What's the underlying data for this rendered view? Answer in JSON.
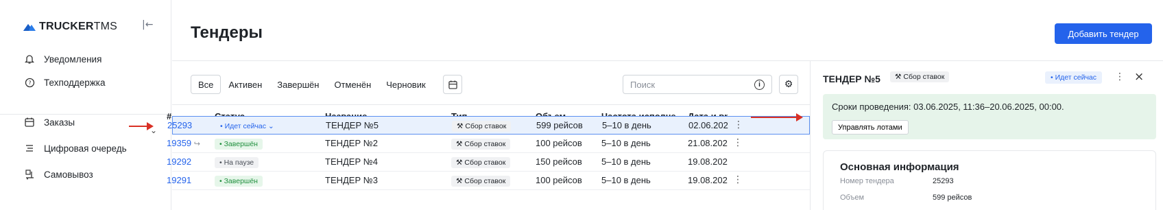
{
  "sidebar": {
    "logo_bold": "TRUCKER",
    "logo_light": "TMS",
    "items": [
      {
        "label": "Уведомления",
        "icon": "bell-icon"
      },
      {
        "label": "Техподдержка",
        "icon": "help-circle-icon"
      },
      {
        "label": "Заказы",
        "icon": "calendar-icon"
      },
      {
        "label": "Цифровая очередь",
        "icon": "queue-icon"
      },
      {
        "label": "Самовывоз",
        "icon": "pickup-icon"
      }
    ]
  },
  "header": {
    "title": "Тендеры",
    "add_button": "Добавить тендер"
  },
  "filters": {
    "tabs": [
      "Все",
      "Активен",
      "Завершён",
      "Отменён",
      "Черновик"
    ],
    "active": "Все",
    "search_placeholder": "Поиск"
  },
  "table": {
    "columns": [
      "#",
      "Статус",
      "Название",
      "Тип",
      "Объем",
      "Частота исполне...",
      "Дата и вр"
    ],
    "rows": [
      {
        "id": "25293",
        "status": "Идет сейчас",
        "status_kind": "live",
        "name": "ТЕНДЕР №5",
        "type": "Сбор ставок",
        "volume": "599 рейсов",
        "freq": "5–10 в день",
        "date": "02.06.202",
        "selected": true,
        "linked": false
      },
      {
        "id": "19359",
        "status": "Завершён",
        "status_kind": "done",
        "name": "ТЕНДЕР №2",
        "type": "Сбор ставок",
        "volume": "100 рейсов",
        "freq": "5–10 в день",
        "date": "21.08.202",
        "selected": false,
        "linked": true
      },
      {
        "id": "19292",
        "status": "На паузе",
        "status_kind": "pause",
        "name": "ТЕНДЕР №4",
        "type": "Сбор ставок",
        "volume": "150 рейсов",
        "freq": "5–10 в день",
        "date": "19.08.202",
        "selected": false,
        "linked": false
      },
      {
        "id": "19291",
        "status": "Завершён",
        "status_kind": "done",
        "name": "ТЕНДЕР №3",
        "type": "Сбор ставок",
        "volume": "100 рейсов",
        "freq": "5–10 в день",
        "date": "19.08.202",
        "selected": false,
        "linked": false
      }
    ]
  },
  "panel": {
    "title": "ТЕНДЕР №5",
    "type": "Сбор ставок",
    "status": "• Идет сейчас",
    "notice": "Сроки проведения: 03.06.2025, 11:36–20.06.2025, 00:00.",
    "manage_button": "Управлять лотами",
    "info_title": "Основная информация",
    "info": [
      {
        "label": "Номер тендера",
        "value": "25293"
      },
      {
        "label": "Объем",
        "value": "599 рейсов"
      }
    ]
  },
  "colors": {
    "accent": "#2463eb",
    "annotation_arrow": "#d93025",
    "notice_bg": "#e6f4ea"
  }
}
